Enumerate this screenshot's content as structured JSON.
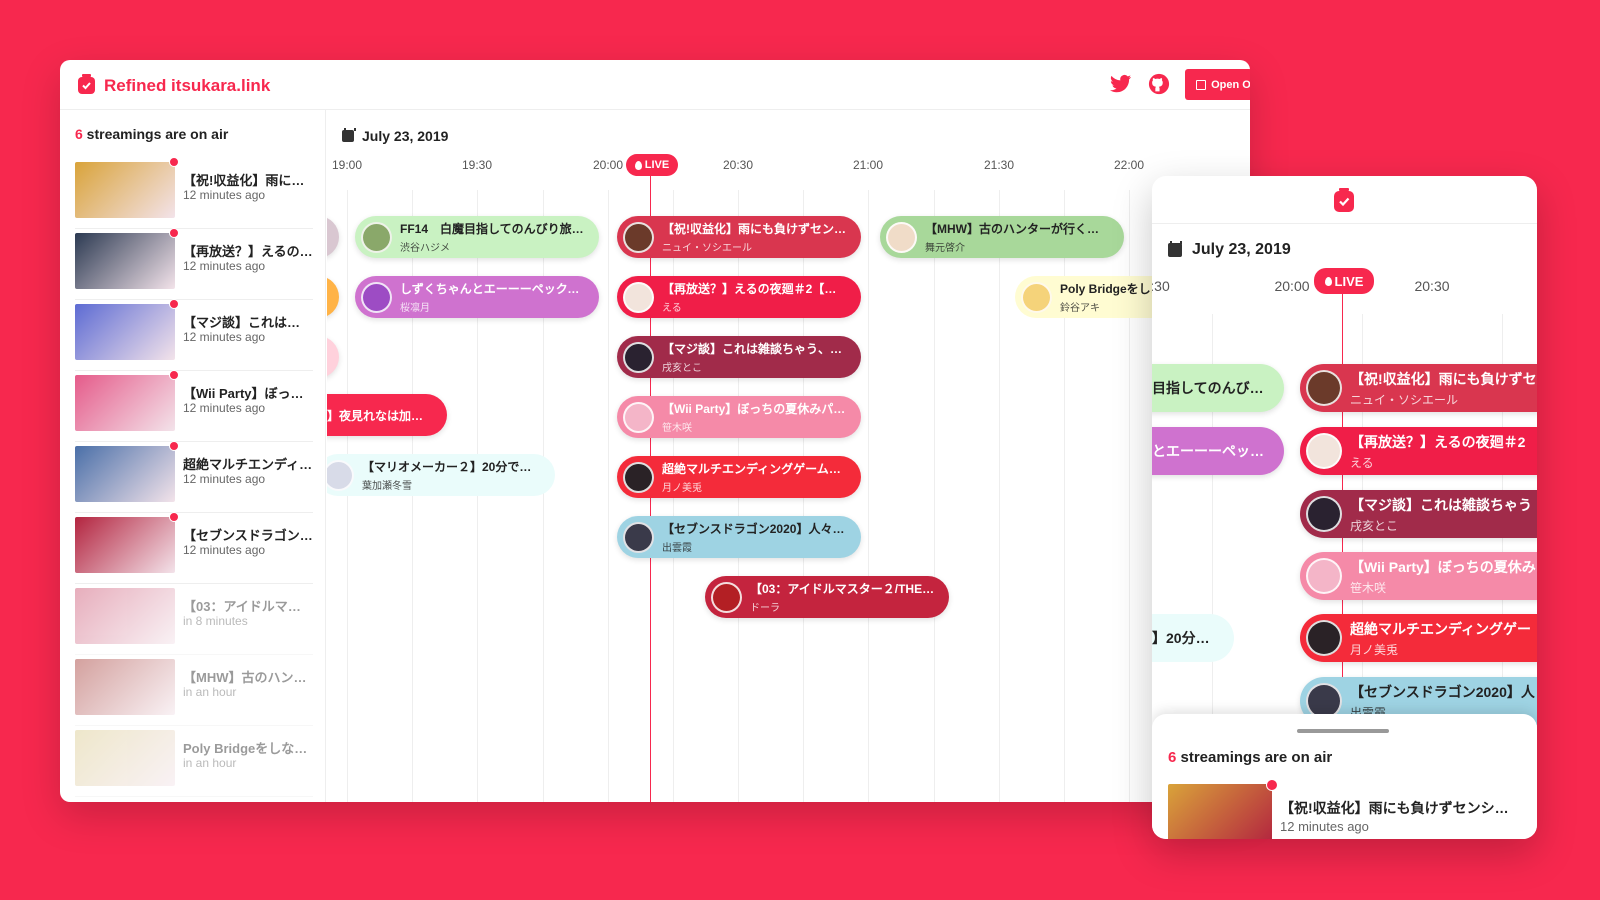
{
  "app": {
    "brand": "Refined itsukara.link",
    "open_original_label": "Open Original",
    "twitter_icon": "twitter-icon",
    "github_icon": "github-icon",
    "brand_color": "#f7284e"
  },
  "sidebar": {
    "count": "6",
    "count_suffix": " streamings are on air",
    "items": [
      {
        "title": "【祝!収益化】雨にも負けずセンシティブにも負けず",
        "sub": "12 minutes ago",
        "live": true,
        "color": "#d9a33a"
      },
      {
        "title": "【再放送？】えるの夜廻＃2",
        "sub": "12 minutes ago",
        "live": true,
        "color": "#2c3a52"
      },
      {
        "title": "【マジ談】これは雑談ちゃう",
        "sub": "12 minutes ago",
        "live": true,
        "color": "#5d6bd3"
      },
      {
        "title": "【Wii Party】ぼっちの夏休み",
        "sub": "12 minutes ago",
        "live": true,
        "color": "#e55b8a"
      },
      {
        "title": "超絶マルチエンディングゲーム",
        "sub": "12 minutes ago",
        "live": true,
        "color": "#4a6fa8"
      },
      {
        "title": "【セブンスドラゴン2020】人々",
        "sub": "12 minutes ago",
        "live": true,
        "color": "#b3243f"
      },
      {
        "title": "【03：アイドルマスター２",
        "sub": "in 8 minutes",
        "live": false,
        "color": "#c94a6a"
      },
      {
        "title": "【MHW】古のハンターが行く",
        "sub": "in an hour",
        "live": false,
        "color": "#a0302a"
      },
      {
        "title": "Poly Bridgeをしながら",
        "sub": "in an hour",
        "live": false,
        "color": "#d9c98a"
      }
    ]
  },
  "timeline": {
    "date": "July 23, 2019",
    "live_label": "LIVE",
    "ticks": [
      "19:00",
      "19:30",
      "20:00",
      "20:30",
      "21:00",
      "21:30",
      "22:00"
    ],
    "streams": [
      {
        "title": "FF14　白魔目指してのんびり旅…",
        "name": "渋谷ハジメ",
        "bg": "#c9f2c2",
        "avatar": "#8aa86a",
        "theme": "light"
      },
      {
        "title": "しずくちゃんとエーーーペックス…",
        "name": "桜凛月",
        "bg": "#cf72cf",
        "avatar": "#9d4cc4",
        "theme": "dark"
      },
      {
        "title": "】夜見れなは加…",
        "name": "",
        "bg": "#f7284e",
        "avatar": "#f7284e",
        "theme": "dark"
      },
      {
        "title": "【マリオメーカー２】20分でクリ…",
        "name": "葉加瀬冬雪",
        "bg": "#eafcfb",
        "avatar": "#d8dbe8",
        "theme": "light"
      },
      {
        "title": "【祝!収益化】雨にも負けずセン…",
        "name": "ニュイ・ソシエール",
        "bg": "#d9364f",
        "avatar": "#6b3a2a",
        "theme": "dark"
      },
      {
        "title": "【再放送？】えるの夜廻＃2【ホ…",
        "name": "える",
        "bg": "#f01e48",
        "avatar": "#f2e4dc",
        "theme": "dark"
      },
      {
        "title": "【マジ談】これは雑談ちゃう、マ…",
        "name": "戌亥とこ",
        "bg": "#a12b4a",
        "avatar": "#2a2230",
        "theme": "dark"
      },
      {
        "title": "【Wii Party】ぼっちの夏休みパ…",
        "name": "笹木咲",
        "bg": "#f58aa8",
        "avatar": "#f4b5c8",
        "theme": "dark"
      },
      {
        "title": "超絶マルチエンディングゲーム・…",
        "name": "月ノ美兎",
        "bg": "#f42b3a",
        "avatar": "#2a2226",
        "theme": "dark"
      },
      {
        "title": "【セブンスドラゴン2020】人々…",
        "name": "出雲霞",
        "bg": "#9ed3e3",
        "avatar": "#3a3a4a",
        "theme": "light"
      },
      {
        "title": "【03：アイドルマスター２/THE I…",
        "name": "ドーラ",
        "bg": "#c4243e",
        "avatar": "#b31f24",
        "theme": "dark"
      },
      {
        "title": "【MHW】古のハンターが行く！…",
        "name": "舞元啓介",
        "bg": "#a8d89a",
        "avatar": "#f0dcc8",
        "theme": "light"
      },
      {
        "title": "Poly Bridgeをし…",
        "name": "鈴谷アキ",
        "bg": "#fffcd2",
        "avatar": "#f5d37a",
        "theme": "light"
      }
    ]
  },
  "mobile": {
    "date": "July 23, 2019",
    "live_label": "LIVE",
    "ticks": [
      ":30",
      "20:00",
      "20:30"
    ],
    "streams": [
      {
        "title": "目指してのんびり…",
        "name": "",
        "bg": "#c9f2c2",
        "theme": "light"
      },
      {
        "title": "とエーーーペック…",
        "name": "",
        "bg": "#cf72cf",
        "theme": "dark"
      },
      {
        "title": "】20分で…",
        "name": "",
        "bg": "#eafcfb",
        "theme": "light"
      },
      {
        "title": "【祝!収益化】雨にも負けずセ",
        "name": "ニュイ・ソシエール",
        "bg": "#d9364f",
        "avatar": "#6b3a2a",
        "theme": "dark"
      },
      {
        "title": "【再放送？】えるの夜廻＃2",
        "name": "える",
        "bg": "#f01e48",
        "avatar": "#f2e4dc",
        "theme": "dark"
      },
      {
        "title": "【マジ談】これは雑談ちゃう",
        "name": "戌亥とこ",
        "bg": "#a12b4a",
        "avatar": "#2a2230",
        "theme": "dark"
      },
      {
        "title": "【Wii Party】ぼっちの夏休み",
        "name": "笹木咲",
        "bg": "#f58aa8",
        "avatar": "#f4b5c8",
        "theme": "dark"
      },
      {
        "title": "超絶マルチエンディングゲー",
        "name": "月ノ美兎",
        "bg": "#f42b3a",
        "avatar": "#2a2226",
        "theme": "dark"
      },
      {
        "title": "【セブンスドラゴン2020】人",
        "name": "出雲霞",
        "bg": "#9ed3e3",
        "avatar": "#3a3a4a",
        "theme": "light"
      }
    ],
    "sheet": {
      "count": "6",
      "count_suffix": " streamings are on air",
      "item_title": "【祝!収益化】雨にも負けずセンシティブにも負けず",
      "item_sub": "12 minutes ago"
    }
  }
}
